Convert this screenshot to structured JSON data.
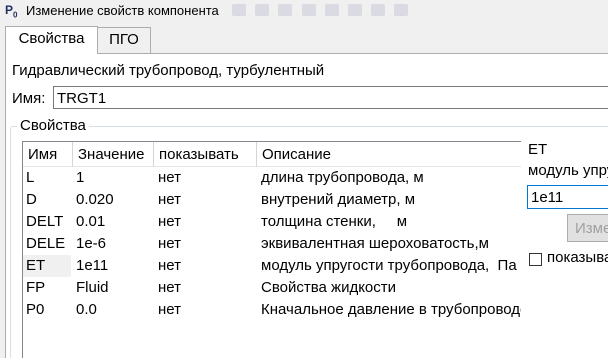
{
  "window": {
    "title": "Изменение свойств компонента"
  },
  "tabs": [
    {
      "label": "Свойства",
      "active": true
    },
    {
      "label": "ПГО",
      "active": false
    }
  ],
  "component": {
    "description": "Гидравлический трубопровод, турбулентный",
    "name_label": "Имя:",
    "name_value": "TRGT1"
  },
  "properties_group": {
    "label": "Свойства",
    "columns": [
      "Имя",
      "Значение",
      "показывать",
      "Описание"
    ],
    "rows": [
      {
        "name": "L",
        "value": "1",
        "show": "нет",
        "description": "длина трубопровода, м"
      },
      {
        "name": "D",
        "value": "0.020",
        "show": "нет",
        "description": "внутрений диаметр,  м"
      },
      {
        "name": "DELT",
        "value": "0.01",
        "show": "нет",
        "description": "толщина стенки,     м"
      },
      {
        "name": "DELE",
        "value": "1e-6",
        "show": "нет",
        "description": "эквивалентная шероховатость,м"
      },
      {
        "name": "ET",
        "value": "1e11",
        "show": "нет",
        "description": "модуль упругости трубопровода,  Па"
      },
      {
        "name": "FP",
        "value": "Fluid",
        "show": "нет",
        "description": "Свойства жидкости"
      },
      {
        "name": "P0",
        "value": "0.0",
        "show": "нет",
        "description": "Кначальное давление в трубопроводе"
      }
    ],
    "selected_row": "ET"
  },
  "editor": {
    "param_name": "ET",
    "param_description": "модуль упругости трубопровода",
    "value": "1e11",
    "apply_button": "Изменить",
    "show_checkbox_label": "показывать",
    "show_checked": false
  }
}
